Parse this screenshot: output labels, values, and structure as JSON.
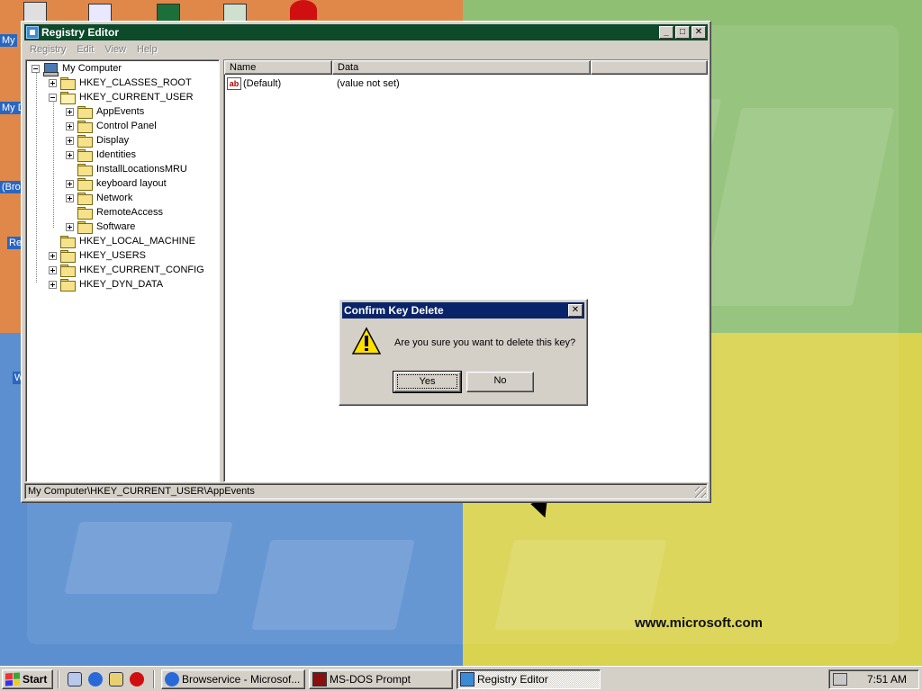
{
  "desktop": {
    "website": "www.microsoft.com",
    "icon_labels": [
      "My",
      "My D",
      "(Bro",
      "Re",
      "W"
    ]
  },
  "registry_window": {
    "title": "Registry Editor",
    "menus": [
      {
        "label": "Registry"
      },
      {
        "label": "Edit"
      },
      {
        "label": "View"
      },
      {
        "label": "Help"
      }
    ],
    "tree": [
      {
        "label": "My Computer",
        "icon": "computer-icon",
        "level": 0,
        "expander": "minus"
      },
      {
        "label": "HKEY_CLASSES_ROOT",
        "icon": "folder-icon",
        "level": 1,
        "expander": "plus"
      },
      {
        "label": "HKEY_CURRENT_USER",
        "icon": "folder-open-icon",
        "level": 1,
        "expander": "minus"
      },
      {
        "label": "AppEvents",
        "icon": "folder-icon",
        "level": 2,
        "expander": "plus"
      },
      {
        "label": "Control Panel",
        "icon": "folder-icon",
        "level": 2,
        "expander": "plus"
      },
      {
        "label": "Display",
        "icon": "folder-icon",
        "level": 2,
        "expander": "plus"
      },
      {
        "label": "Identities",
        "icon": "folder-icon",
        "level": 2,
        "expander": "plus"
      },
      {
        "label": "InstallLocationsMRU",
        "icon": "folder-icon",
        "level": 2,
        "expander": "none"
      },
      {
        "label": "keyboard layout",
        "icon": "folder-icon",
        "level": 2,
        "expander": "plus"
      },
      {
        "label": "Network",
        "icon": "folder-icon",
        "level": 2,
        "expander": "plus"
      },
      {
        "label": "RemoteAccess",
        "icon": "folder-icon",
        "level": 2,
        "expander": "none"
      },
      {
        "label": "Software",
        "icon": "folder-icon",
        "level": 2,
        "expander": "plus"
      },
      {
        "label": "HKEY_LOCAL_MACHINE",
        "icon": "folder-icon",
        "level": 1,
        "expander": "none"
      },
      {
        "label": "HKEY_USERS",
        "icon": "folder-icon",
        "level": 1,
        "expander": "plus"
      },
      {
        "label": "HKEY_CURRENT_CONFIG",
        "icon": "folder-icon",
        "level": 1,
        "expander": "plus"
      },
      {
        "label": "HKEY_DYN_DATA",
        "icon": "folder-icon",
        "level": 1,
        "expander": "plus"
      }
    ],
    "list": {
      "columns": [
        "Name",
        "Data",
        ""
      ],
      "rows": [
        {
          "name": "(Default)",
          "data": "(value not set)",
          "icon": "string-value-icon"
        }
      ]
    },
    "status": "My Computer\\HKEY_CURRENT_USER\\AppEvents"
  },
  "dialog": {
    "title": "Confirm Key Delete",
    "message": "Are you sure you want to delete this key?",
    "icon": "warning-icon",
    "yes_label": "Yes",
    "no_label": "No"
  },
  "taskbar": {
    "start_label": "Start",
    "quick_launch": [
      "show-desktop-icon",
      "internet-explorer-icon",
      "outlook-express-icon",
      "opera-icon"
    ],
    "tasks": [
      {
        "label": "Browservice - Microsof...",
        "icon": "internet-explorer-icon",
        "active": false
      },
      {
        "label": "MS-DOS Prompt",
        "icon": "msdos-icon",
        "active": false
      },
      {
        "label": "Registry Editor",
        "icon": "registry-editor-icon",
        "active": true
      }
    ],
    "clock": "7:51 AM"
  },
  "colors": {
    "titlebar_active": "#0a246a",
    "titlebar_inactive": "#0c4a2a",
    "face": "#d4d0c8",
    "desktop_orange": "#e0884a",
    "desktop_green": "#8fbf73",
    "desktop_blue": "#5b8fd0",
    "desktop_yellow": "#d9d34f"
  }
}
